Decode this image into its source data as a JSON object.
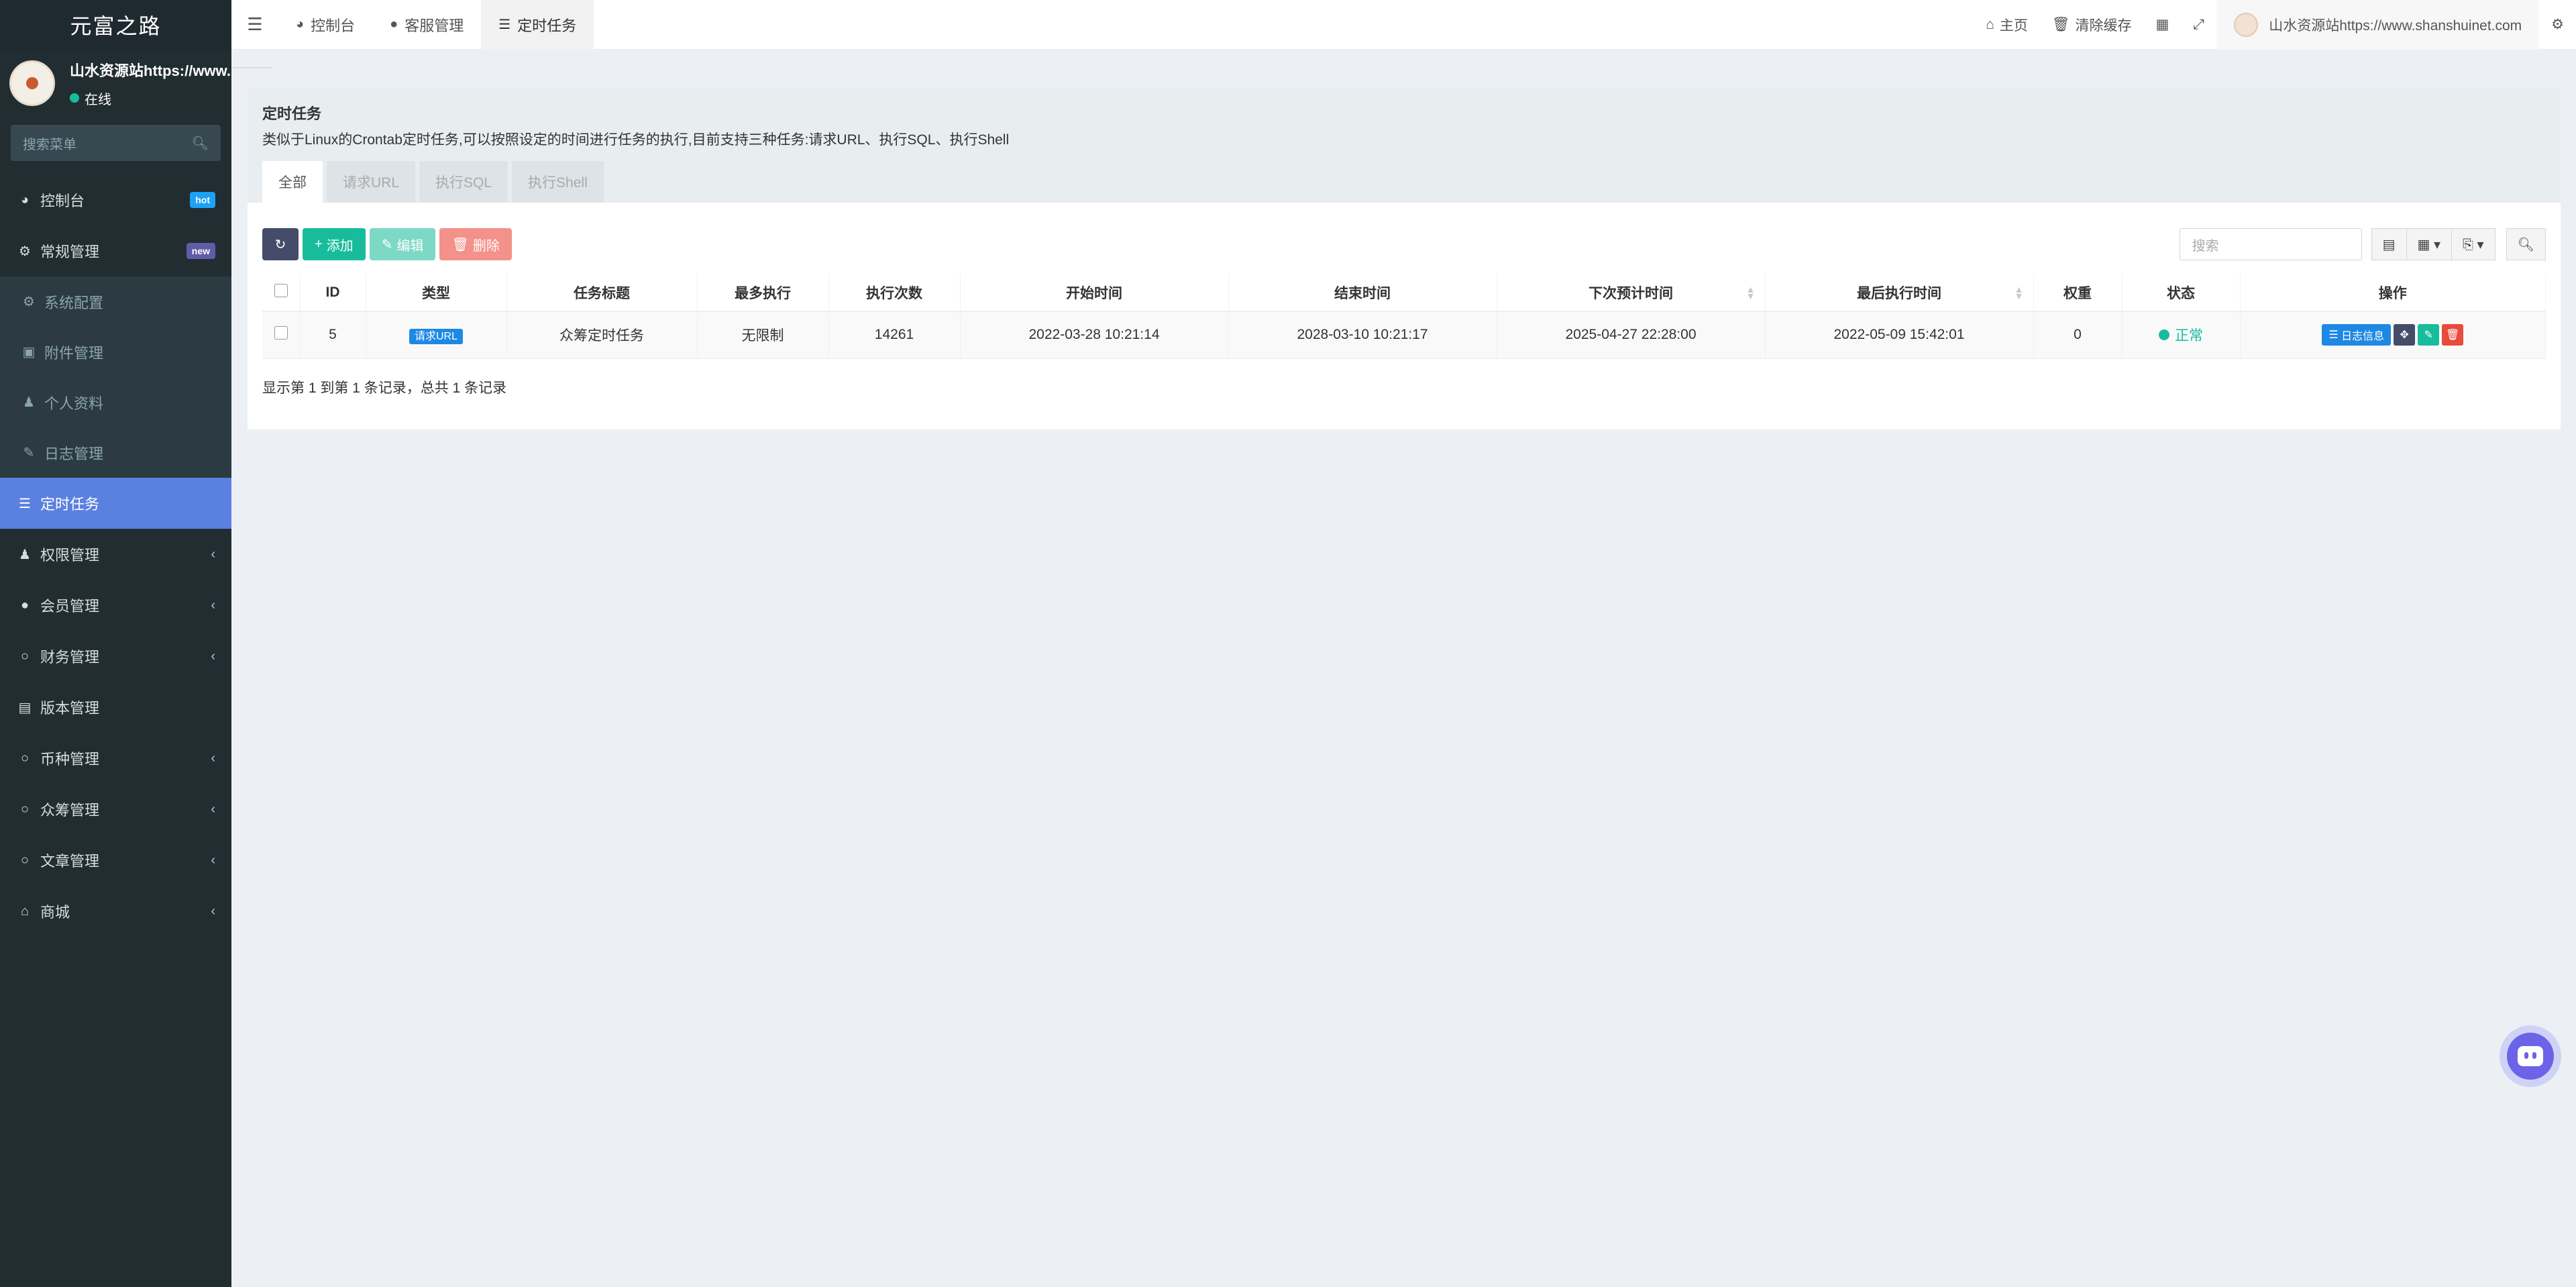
{
  "sidebar": {
    "brand": "元富之路",
    "user_name": "山水资源站https://www.s",
    "user_status": "在线",
    "search_placeholder": "搜索菜单",
    "items": [
      {
        "label": "控制台",
        "icon": "dashboard-icon",
        "badge": "hot"
      },
      {
        "label": "常规管理",
        "icon": "cogs-icon",
        "badge": "new"
      },
      {
        "label": "系统配置",
        "icon": "gear-icon"
      },
      {
        "label": "附件管理",
        "icon": "file-image-icon"
      },
      {
        "label": "个人资料",
        "icon": "user-icon"
      },
      {
        "label": "日志管理",
        "icon": "log-icon"
      },
      {
        "label": "定时任务",
        "icon": "tasks-icon"
      },
      {
        "label": "权限管理",
        "icon": "group-icon"
      },
      {
        "label": "会员管理",
        "icon": "user-circle-icon"
      },
      {
        "label": "财务管理",
        "icon": "circle-icon"
      },
      {
        "label": "版本管理",
        "icon": "file-icon"
      },
      {
        "label": "币种管理",
        "icon": "circle-icon"
      },
      {
        "label": "众筹管理",
        "icon": "circle-icon"
      },
      {
        "label": "文章管理",
        "icon": "circle-icon"
      },
      {
        "label": "商城",
        "icon": "home-icon"
      }
    ]
  },
  "topbar": {
    "tabs": [
      "控制台",
      "客服管理",
      "定时任务"
    ],
    "home": "主页",
    "clear_cache": "清除缓存",
    "user": "山水资源站https://www.shanshuinet.com"
  },
  "panel": {
    "title": "定时任务",
    "description": "类似于Linux的Crontab定时任务,可以按照设定的时间进行任务的执行,目前支持三种任务:请求URL、执行SQL、执行Shell",
    "tabs": [
      "全部",
      "请求URL",
      "执行SQL",
      "执行Shell"
    ]
  },
  "toolbar": {
    "add": "添加",
    "edit": "编辑",
    "delete": "删除",
    "search_placeholder": "搜索"
  },
  "table": {
    "headers": [
      "ID",
      "类型",
      "任务标题",
      "最多执行",
      "执行次数",
      "开始时间",
      "结束时间",
      "下次预计时间",
      "最后执行时间",
      "权重",
      "状态",
      "操作"
    ],
    "rows": [
      {
        "id": "5",
        "type": "请求URL",
        "title": "众筹定时任务",
        "max_exec": "无限制",
        "exec_count": "14261",
        "start_time": "2022-03-28 10:21:14",
        "end_time": "2028-03-10 10:21:17",
        "next_time": "2025-04-27 22:28:00",
        "last_time": "2022-05-09 15:42:01",
        "weight": "0",
        "status": "正常",
        "log_label": "日志信息"
      }
    ]
  },
  "pagination": {
    "info": "显示第 1 到第 1 条记录，总共 1 条记录"
  },
  "colors": {
    "sidebar_bg": "#222d32",
    "active": "#5a80e0",
    "green": "#18bc9c",
    "blue": "#1e88e5",
    "red": "#e74c3c"
  }
}
